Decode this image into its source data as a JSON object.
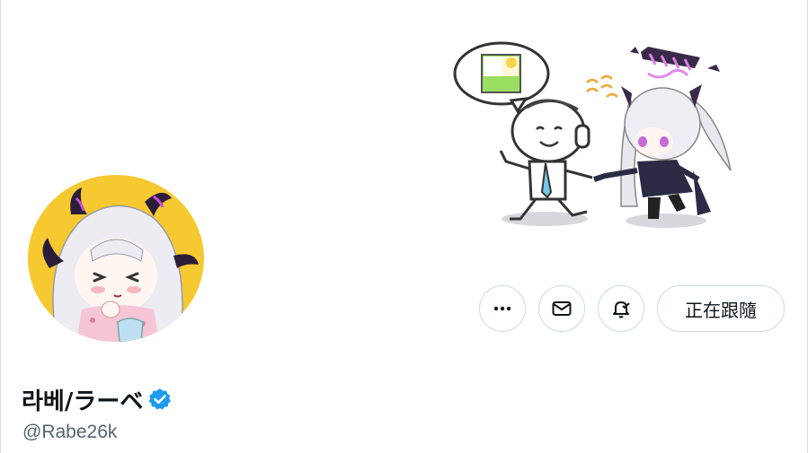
{
  "profile": {
    "display_name": "라베/ラーベ",
    "handle": "@Rabe26k",
    "verified": true,
    "verified_color": "#1d9bf0"
  },
  "actions": {
    "more_icon": "more-horizontal-icon",
    "message_icon": "mail-icon",
    "notify_icon": "bell-notify-icon",
    "follow_label": "正在跟隨"
  },
  "colors": {
    "avatar_background": "#f7c931",
    "horn_color": "#2b1d3a",
    "accent_pink": "#c84fd8",
    "border": "#cfd9de",
    "handle": "#536471"
  }
}
